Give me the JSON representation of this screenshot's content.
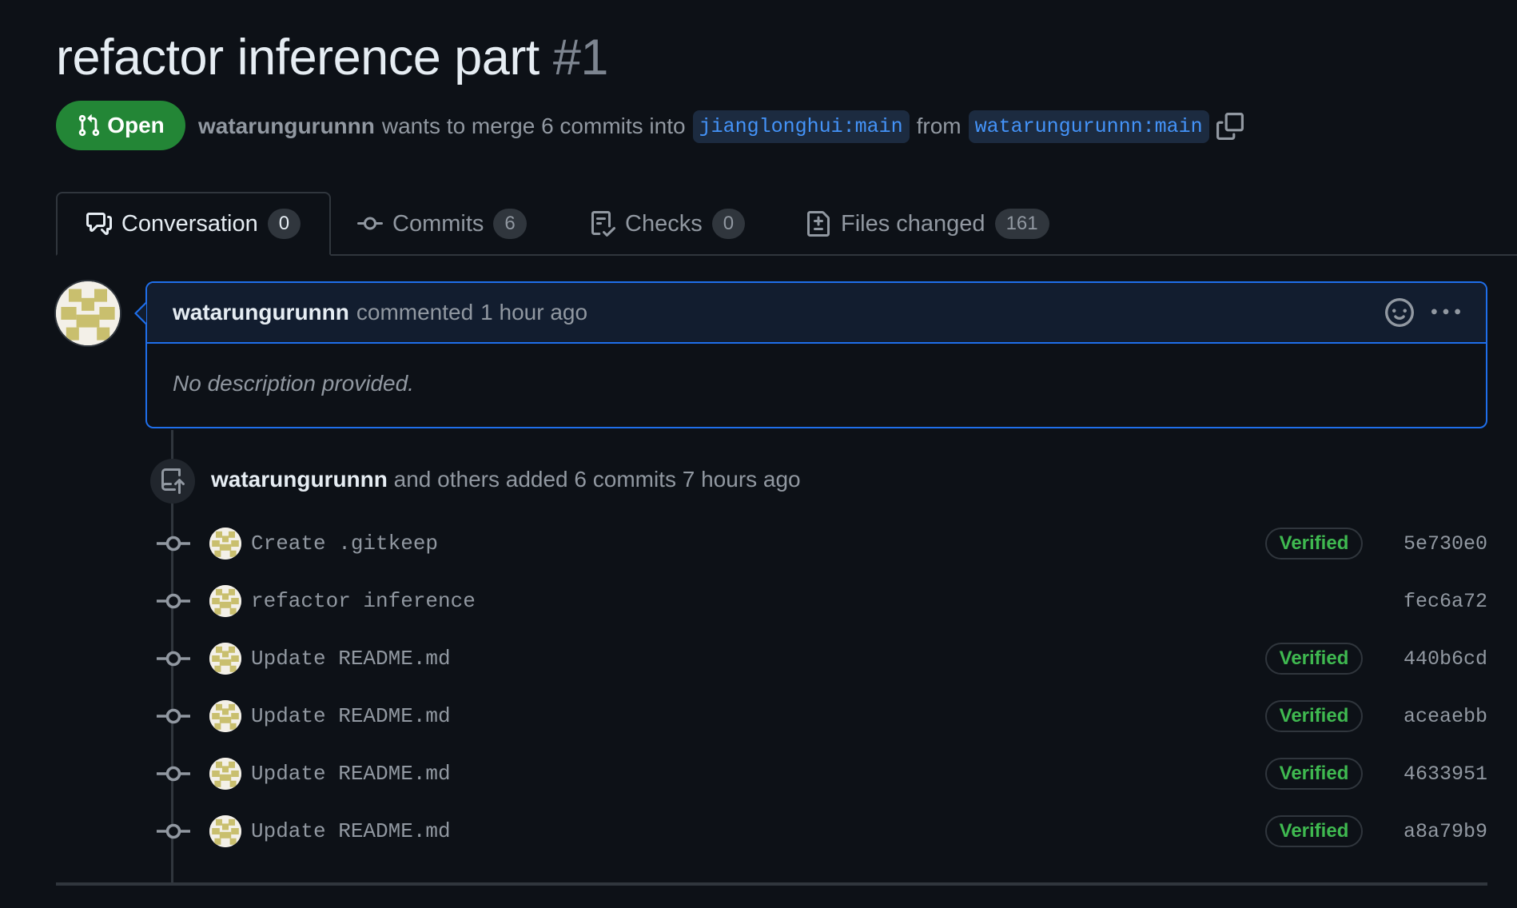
{
  "pr": {
    "title": "refactor inference part",
    "number": "#1",
    "state": "Open",
    "author": "watarungurunnn",
    "merge_text": "wants to merge 6 commits into",
    "base_branch": "jianglonghui:main",
    "from_text": "from",
    "head_branch": "watarungurunnn:main"
  },
  "tabs": [
    {
      "label": "Conversation",
      "count": "0",
      "icon": "comment-discussion-icon",
      "active": true
    },
    {
      "label": "Commits",
      "count": "6",
      "icon": "git-commit-icon"
    },
    {
      "label": "Checks",
      "count": "0",
      "icon": "checklist-icon"
    },
    {
      "label": "Files changed",
      "count": "161",
      "icon": "file-diff-icon"
    }
  ],
  "comment": {
    "author": "watarungurunnn",
    "action": "commented",
    "time": "1 hour ago",
    "body": "No description provided."
  },
  "push_event": {
    "author": "watarungurunnn",
    "text": "and others added 6 commits 7 hours ago"
  },
  "commits": [
    {
      "message": "Create .gitkeep",
      "verified": "Verified",
      "sha": "5e730e0"
    },
    {
      "message": "refactor inference",
      "verified": "",
      "sha": "fec6a72"
    },
    {
      "message": "Update README.md",
      "verified": "Verified",
      "sha": "440b6cd"
    },
    {
      "message": "Update README.md",
      "verified": "Verified",
      "sha": "aceaebb"
    },
    {
      "message": "Update README.md",
      "verified": "Verified",
      "sha": "4633951"
    },
    {
      "message": "Update README.md",
      "verified": "Verified",
      "sha": "a8a79b9"
    }
  ],
  "colors": {
    "background": "#0d1117",
    "open_green": "#238636",
    "verified_green": "#3fb950",
    "branch_blue": "#4493f8",
    "comment_border": "#1f6feb"
  }
}
